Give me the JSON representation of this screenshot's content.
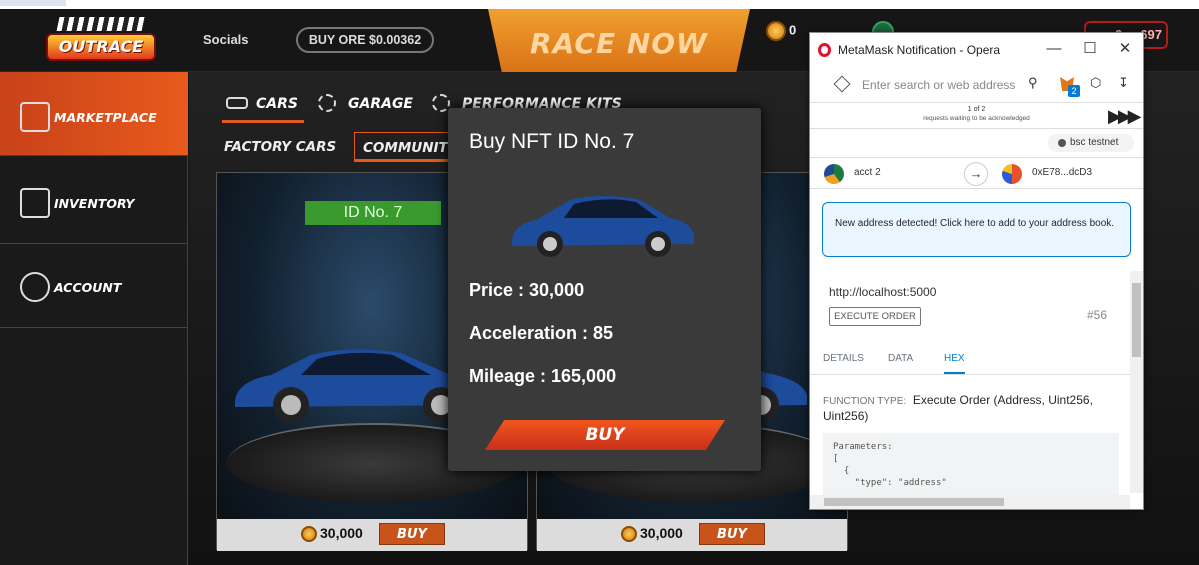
{
  "header": {
    "logo_text": "OUTRACE",
    "socials": "Socials",
    "buy_ore": "BUY ORE $0.00362",
    "race_now": "RACE NOW",
    "balance1": "0",
    "balance2": "",
    "wallet": "0x...697"
  },
  "sidebar": {
    "items": [
      {
        "label": "MARKETPLACE"
      },
      {
        "label": "INVENTORY"
      },
      {
        "label": "ACCOUNT"
      }
    ]
  },
  "tabs": {
    "top": [
      {
        "label": "CARS"
      },
      {
        "label": "GARAGE"
      },
      {
        "label": "PERFORMANCE KITS"
      }
    ],
    "sub": [
      {
        "label": "FACTORY CARS"
      },
      {
        "label": "COMMUNITY"
      }
    ]
  },
  "cards": [
    {
      "id_label": "ID No. 7",
      "price": "30,000",
      "buy": "BUY"
    },
    {
      "id_label": "",
      "price": "30,000",
      "buy": "BUY"
    }
  ],
  "modal": {
    "title": "Buy NFT ID No. 7",
    "price": "Price : 30,000",
    "acceleration": "Acceleration : 85",
    "mileage": "Mileage : 165,000",
    "buy": "BUY"
  },
  "metamask": {
    "window_title": "MetaMask Notification - Opera",
    "search_placeholder": "Enter search or web address",
    "ext_badge": "2",
    "pager_count": "1 of 2",
    "pager_text": "requests waiting to be acknowledged",
    "network": "bsc testnet",
    "from_account": "acct 2",
    "to_account": "0xE78...dcD3",
    "notice": "New address detected! Click here to add to your address book.",
    "origin": "http://localhost:5000",
    "method": "EXECUTE ORDER",
    "nonce": "#56",
    "tabs": [
      "DETAILS",
      "DATA",
      "HEX"
    ],
    "function_type_label": "FUNCTION TYPE:",
    "function_type": "Execute Order (Address, Uint256, Uint256)",
    "params": "Parameters:\n[\n  {\n    \"type\": \"address\""
  },
  "colors": {
    "accent": "#e35a1c",
    "id_badge": "#3a9a2d",
    "metamask_blue": "#037dd6"
  }
}
